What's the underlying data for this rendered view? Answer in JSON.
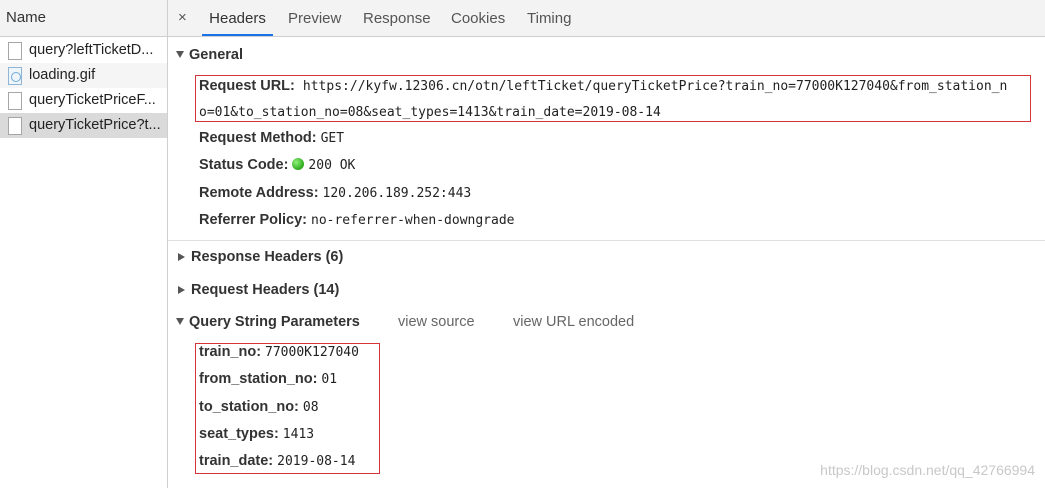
{
  "left": {
    "header": "Name",
    "requests": [
      {
        "label": "query?leftTicketD...",
        "icon": "document-icon"
      },
      {
        "label": "loading.gif",
        "icon": "image-icon"
      },
      {
        "label": "queryTicketPriceF...",
        "icon": "document-icon"
      },
      {
        "label": "queryTicketPrice?t...",
        "icon": "document-icon",
        "selected": true
      }
    ]
  },
  "tabs": {
    "close": "×",
    "items": [
      "Headers",
      "Preview",
      "Response",
      "Cookies",
      "Timing"
    ],
    "active": "Headers",
    "active_color": "#1a73e8"
  },
  "general": {
    "title": "General",
    "request_url_label": "Request URL:",
    "request_url_line1": "https://kyfw.12306.cn/otn/leftTicket/queryTicketPrice?train_no=77000K127040&from_station_n",
    "request_url_line2": "o=01&to_station_no=08&seat_types=1413&train_date=2019-08-14",
    "request_method_label": "Request Method:",
    "request_method": "GET",
    "status_code_label": "Status Code:",
    "status_code": "200 OK",
    "remote_address_label": "Remote Address:",
    "remote_address": "120.206.189.252:443",
    "referrer_policy_label": "Referrer Policy:",
    "referrer_policy": "no-referrer-when-downgrade"
  },
  "response_headers": "Response Headers (6)",
  "request_headers": "Request Headers (14)",
  "query": {
    "title": "Query String Parameters",
    "view_source": "view source",
    "view_url_encoded": "view URL encoded",
    "params": [
      {
        "k": "train_no:",
        "v": "77000K127040"
      },
      {
        "k": "from_station_no:",
        "v": "01"
      },
      {
        "k": "to_station_no:",
        "v": "08"
      },
      {
        "k": "seat_types:",
        "v": "1413"
      },
      {
        "k": "train_date:",
        "v": "2019-08-14"
      }
    ]
  },
  "highlight_color": "#d6363a",
  "watermark": "https://blog.csdn.net/qq_42766994"
}
